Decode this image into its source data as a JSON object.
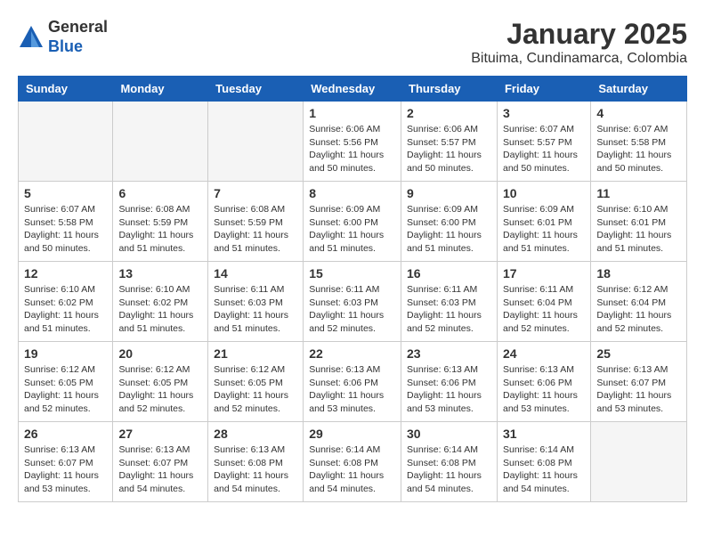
{
  "header": {
    "logo_line1": "General",
    "logo_line2": "Blue",
    "title": "January 2025",
    "subtitle": "Bituima, Cundinamarca, Colombia"
  },
  "calendar": {
    "weekdays": [
      "Sunday",
      "Monday",
      "Tuesday",
      "Wednesday",
      "Thursday",
      "Friday",
      "Saturday"
    ],
    "weeks": [
      [
        {
          "day": "",
          "info": ""
        },
        {
          "day": "",
          "info": ""
        },
        {
          "day": "",
          "info": ""
        },
        {
          "day": "1",
          "info": "Sunrise: 6:06 AM\nSunset: 5:56 PM\nDaylight: 11 hours\nand 50 minutes."
        },
        {
          "day": "2",
          "info": "Sunrise: 6:06 AM\nSunset: 5:57 PM\nDaylight: 11 hours\nand 50 minutes."
        },
        {
          "day": "3",
          "info": "Sunrise: 6:07 AM\nSunset: 5:57 PM\nDaylight: 11 hours\nand 50 minutes."
        },
        {
          "day": "4",
          "info": "Sunrise: 6:07 AM\nSunset: 5:58 PM\nDaylight: 11 hours\nand 50 minutes."
        }
      ],
      [
        {
          "day": "5",
          "info": "Sunrise: 6:07 AM\nSunset: 5:58 PM\nDaylight: 11 hours\nand 50 minutes."
        },
        {
          "day": "6",
          "info": "Sunrise: 6:08 AM\nSunset: 5:59 PM\nDaylight: 11 hours\nand 51 minutes."
        },
        {
          "day": "7",
          "info": "Sunrise: 6:08 AM\nSunset: 5:59 PM\nDaylight: 11 hours\nand 51 minutes."
        },
        {
          "day": "8",
          "info": "Sunrise: 6:09 AM\nSunset: 6:00 PM\nDaylight: 11 hours\nand 51 minutes."
        },
        {
          "day": "9",
          "info": "Sunrise: 6:09 AM\nSunset: 6:00 PM\nDaylight: 11 hours\nand 51 minutes."
        },
        {
          "day": "10",
          "info": "Sunrise: 6:09 AM\nSunset: 6:01 PM\nDaylight: 11 hours\nand 51 minutes."
        },
        {
          "day": "11",
          "info": "Sunrise: 6:10 AM\nSunset: 6:01 PM\nDaylight: 11 hours\nand 51 minutes."
        }
      ],
      [
        {
          "day": "12",
          "info": "Sunrise: 6:10 AM\nSunset: 6:02 PM\nDaylight: 11 hours\nand 51 minutes."
        },
        {
          "day": "13",
          "info": "Sunrise: 6:10 AM\nSunset: 6:02 PM\nDaylight: 11 hours\nand 51 minutes."
        },
        {
          "day": "14",
          "info": "Sunrise: 6:11 AM\nSunset: 6:03 PM\nDaylight: 11 hours\nand 51 minutes."
        },
        {
          "day": "15",
          "info": "Sunrise: 6:11 AM\nSunset: 6:03 PM\nDaylight: 11 hours\nand 52 minutes."
        },
        {
          "day": "16",
          "info": "Sunrise: 6:11 AM\nSunset: 6:03 PM\nDaylight: 11 hours\nand 52 minutes."
        },
        {
          "day": "17",
          "info": "Sunrise: 6:11 AM\nSunset: 6:04 PM\nDaylight: 11 hours\nand 52 minutes."
        },
        {
          "day": "18",
          "info": "Sunrise: 6:12 AM\nSunset: 6:04 PM\nDaylight: 11 hours\nand 52 minutes."
        }
      ],
      [
        {
          "day": "19",
          "info": "Sunrise: 6:12 AM\nSunset: 6:05 PM\nDaylight: 11 hours\nand 52 minutes."
        },
        {
          "day": "20",
          "info": "Sunrise: 6:12 AM\nSunset: 6:05 PM\nDaylight: 11 hours\nand 52 minutes."
        },
        {
          "day": "21",
          "info": "Sunrise: 6:12 AM\nSunset: 6:05 PM\nDaylight: 11 hours\nand 52 minutes."
        },
        {
          "day": "22",
          "info": "Sunrise: 6:13 AM\nSunset: 6:06 PM\nDaylight: 11 hours\nand 53 minutes."
        },
        {
          "day": "23",
          "info": "Sunrise: 6:13 AM\nSunset: 6:06 PM\nDaylight: 11 hours\nand 53 minutes."
        },
        {
          "day": "24",
          "info": "Sunrise: 6:13 AM\nSunset: 6:06 PM\nDaylight: 11 hours\nand 53 minutes."
        },
        {
          "day": "25",
          "info": "Sunrise: 6:13 AM\nSunset: 6:07 PM\nDaylight: 11 hours\nand 53 minutes."
        }
      ],
      [
        {
          "day": "26",
          "info": "Sunrise: 6:13 AM\nSunset: 6:07 PM\nDaylight: 11 hours\nand 53 minutes."
        },
        {
          "day": "27",
          "info": "Sunrise: 6:13 AM\nSunset: 6:07 PM\nDaylight: 11 hours\nand 54 minutes."
        },
        {
          "day": "28",
          "info": "Sunrise: 6:13 AM\nSunset: 6:08 PM\nDaylight: 11 hours\nand 54 minutes."
        },
        {
          "day": "29",
          "info": "Sunrise: 6:14 AM\nSunset: 6:08 PM\nDaylight: 11 hours\nand 54 minutes."
        },
        {
          "day": "30",
          "info": "Sunrise: 6:14 AM\nSunset: 6:08 PM\nDaylight: 11 hours\nand 54 minutes."
        },
        {
          "day": "31",
          "info": "Sunrise: 6:14 AM\nSunset: 6:08 PM\nDaylight: 11 hours\nand 54 minutes."
        },
        {
          "day": "",
          "info": ""
        }
      ]
    ]
  }
}
